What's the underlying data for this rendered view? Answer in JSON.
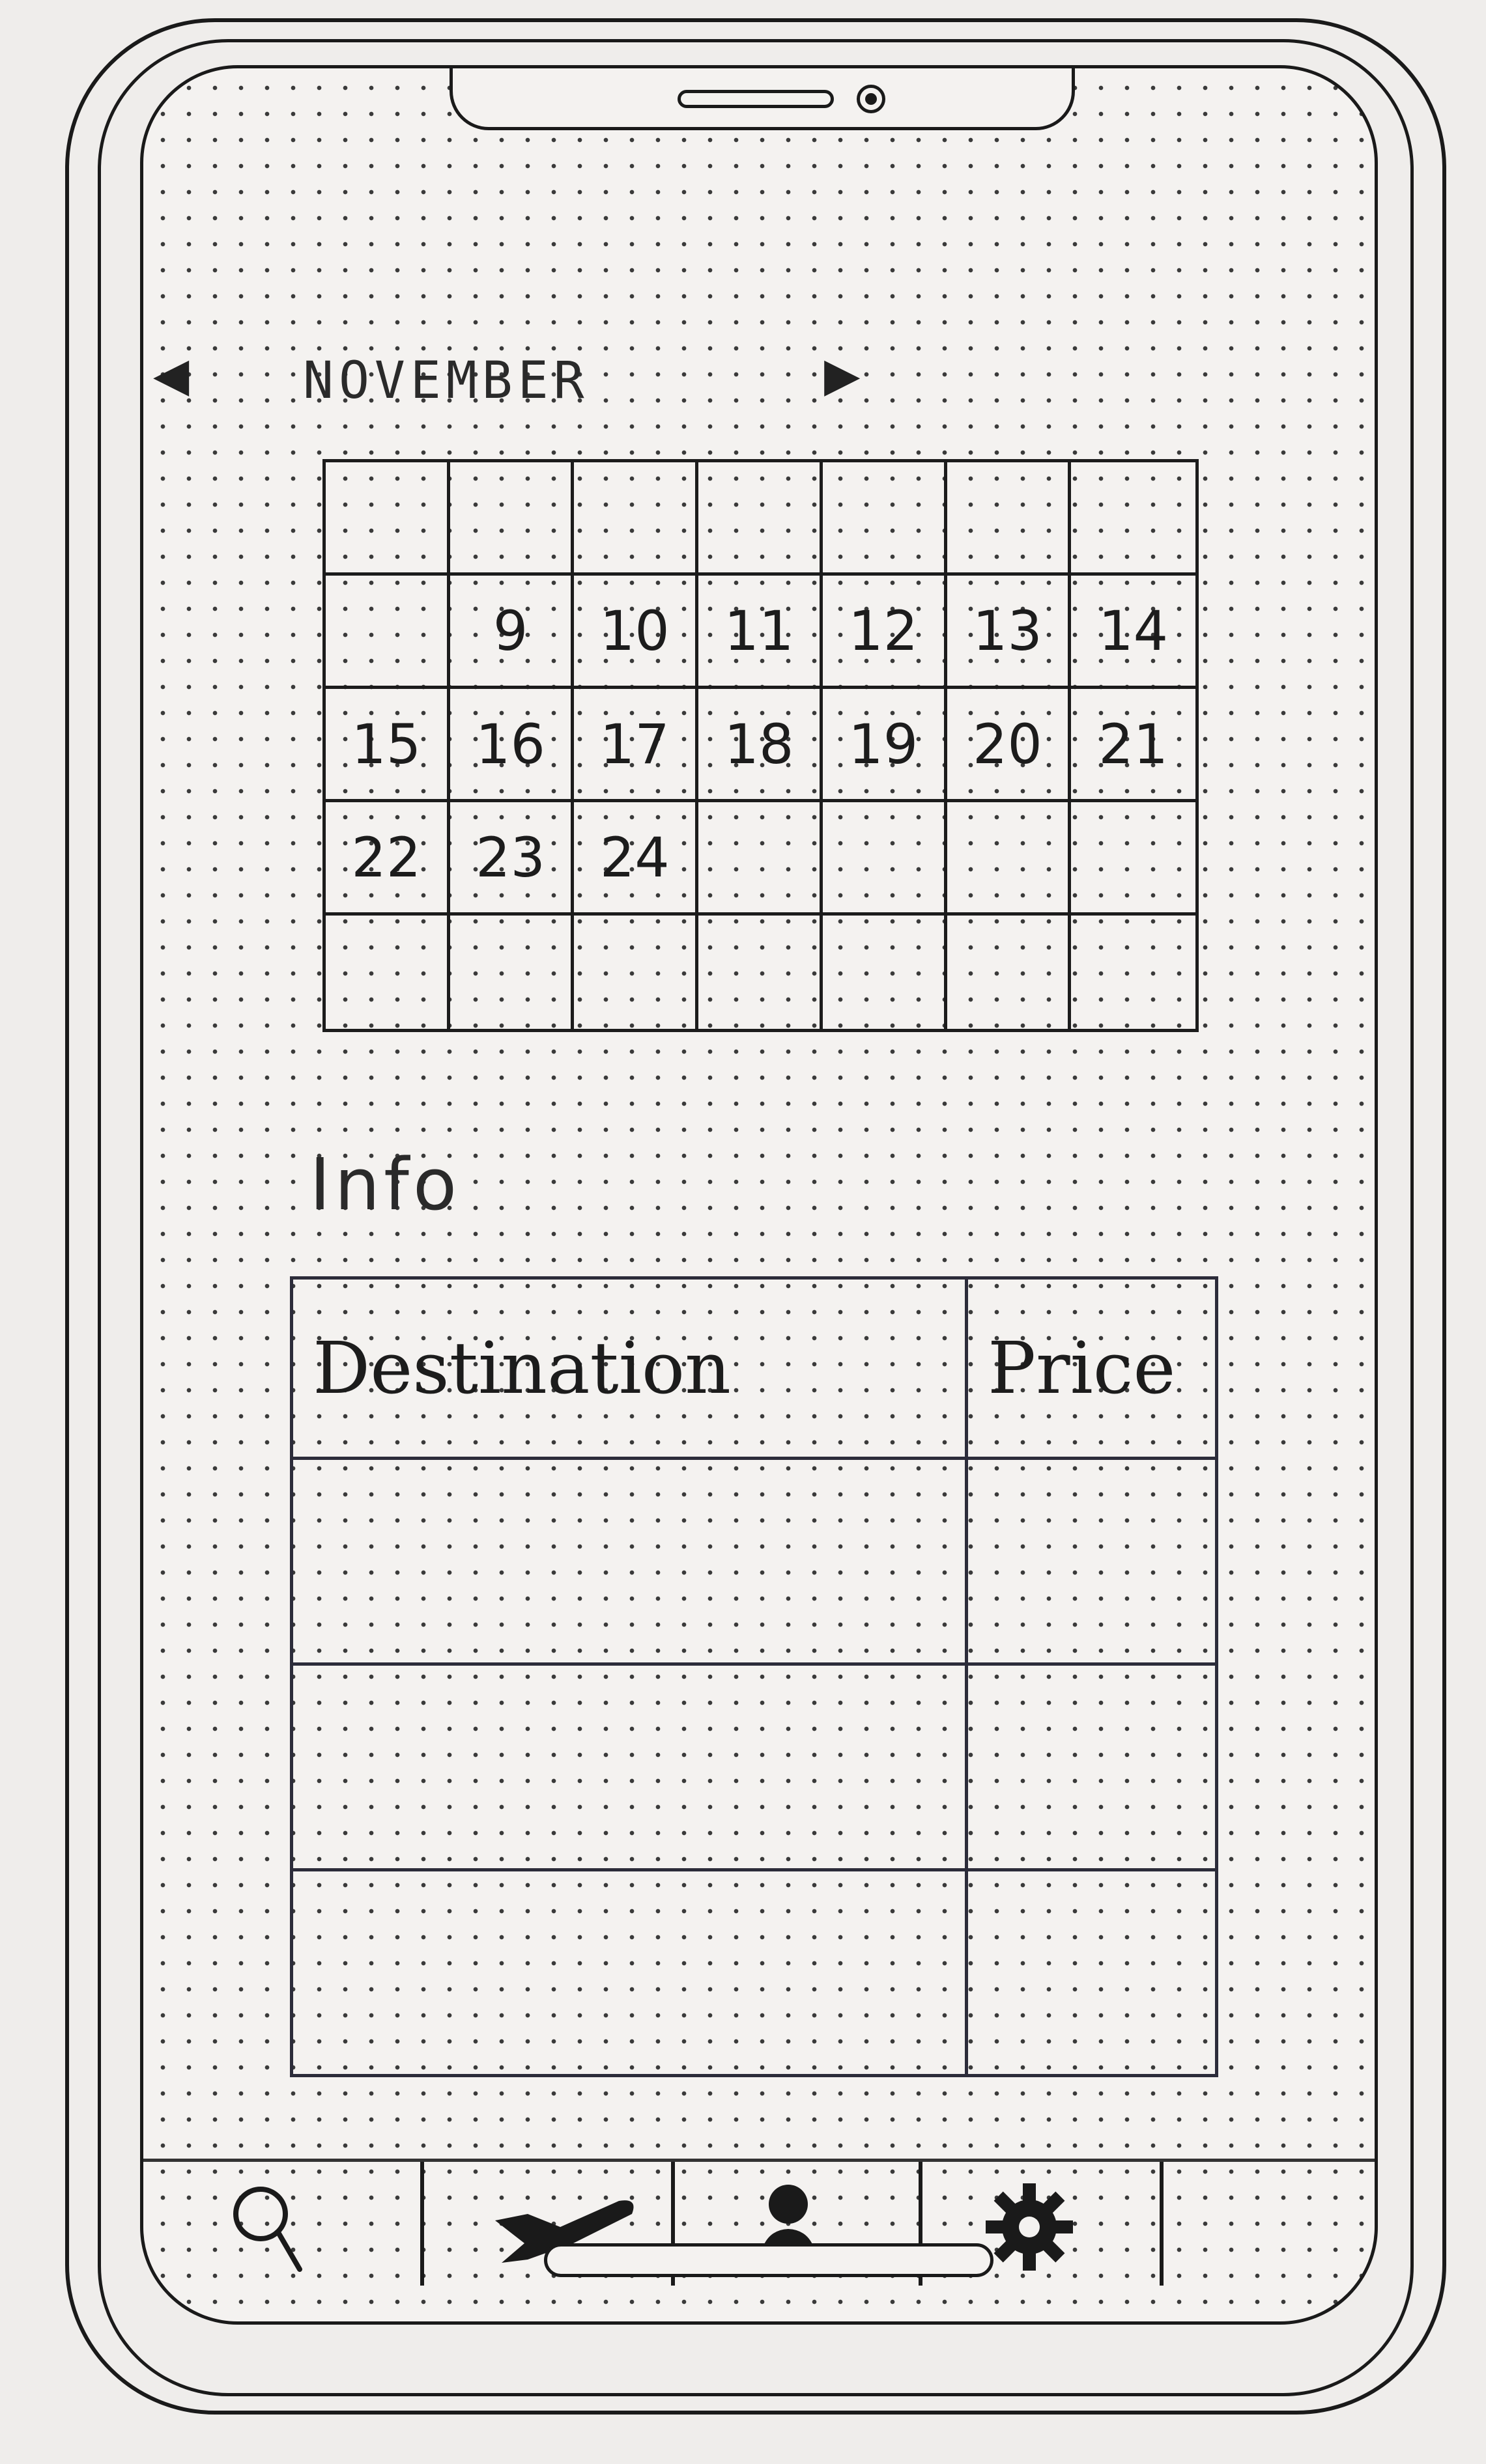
{
  "calendar": {
    "month": "NOVEMBER",
    "prev_arrow": "◀",
    "next_arrow": "▶",
    "rows": [
      [
        "",
        "",
        "",
        "",
        "",
        "",
        ""
      ],
      [
        "",
        "9",
        "10",
        "11",
        "12",
        "13",
        "14"
      ],
      [
        "15",
        "16",
        "17",
        "18",
        "19",
        "20",
        "21"
      ],
      [
        "22",
        "23",
        "24",
        "",
        "",
        "",
        ""
      ],
      [
        "",
        "",
        "",
        "",
        "",
        "",
        ""
      ]
    ]
  },
  "info": {
    "title": "Info",
    "columns": [
      "Destination",
      "Price"
    ],
    "rows": [
      [
        "",
        ""
      ],
      [
        "",
        ""
      ],
      [
        "",
        ""
      ]
    ]
  },
  "tabs": [
    {
      "name": "search",
      "icon": "search-icon"
    },
    {
      "name": "flights",
      "icon": "airplane-icon"
    },
    {
      "name": "profile",
      "icon": "person-icon"
    },
    {
      "name": "settings",
      "icon": "gear-icon"
    }
  ]
}
